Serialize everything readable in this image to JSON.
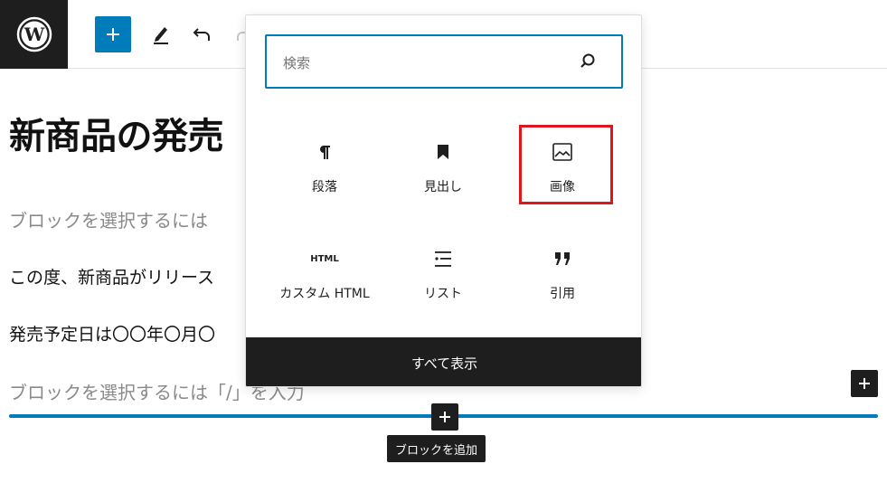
{
  "toolbar": {
    "logo_icon": "wordpress-logo",
    "add_block_icon": "plus-icon",
    "tools_icon": "pencil-icon",
    "undo_icon": "undo-icon",
    "redo_icon": "redo-icon"
  },
  "editor": {
    "title": "新商品の発売",
    "placeholder_1": "ブロックを選択するには",
    "paragraph_1": "この度、新商品がリリース",
    "paragraph_2": "発売予定日は〇〇年〇月〇",
    "placeholder_2": "ブロックを選択するには「/」を入力"
  },
  "inserter": {
    "search_placeholder": "検索",
    "blocks": [
      {
        "label": "段落",
        "icon": "paragraph-icon"
      },
      {
        "label": "見出し",
        "icon": "bookmark-icon"
      },
      {
        "label": "画像",
        "icon": "image-icon"
      },
      {
        "label": "HTML",
        "icon_text": "HTML"
      },
      {
        "label": "カスタム HTML",
        "icon": "html-icon"
      },
      {
        "label": "リスト",
        "icon": "list-icon"
      },
      {
        "label": "引用",
        "icon": "quote-icon"
      }
    ],
    "show_all_label": "すべて表示"
  },
  "add_block_tooltip": "ブロックを追加",
  "colors": {
    "accent": "#007cba",
    "dark": "#1e1e1e",
    "highlight": "#e0161e"
  }
}
